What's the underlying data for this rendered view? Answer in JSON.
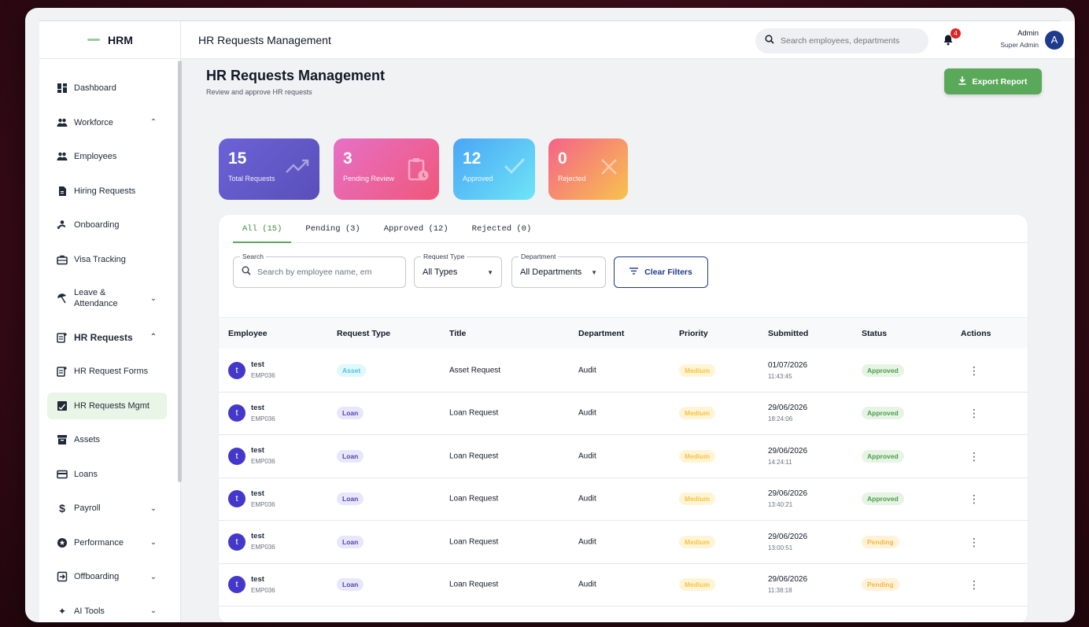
{
  "brand": {
    "name": "HRM"
  },
  "header": {
    "title": "HR Requests Management",
    "search_placeholder": "Search employees, departments",
    "notification_count": "4",
    "user_name": "Admin",
    "user_role": "Super Admin",
    "avatar_initial": "A"
  },
  "sidebar": {
    "items": [
      {
        "label": "Dashboard",
        "icon": "dashboard-icon"
      },
      {
        "label": "Workforce",
        "icon": "people-icon",
        "chevron": "^"
      },
      {
        "label": "Employees",
        "icon": "people-icon"
      },
      {
        "label": "Hiring Requests",
        "icon": "document-icon"
      },
      {
        "label": "Onboarding",
        "icon": "person-add-icon"
      },
      {
        "label": "Visa Tracking",
        "icon": "briefcase-icon"
      },
      {
        "label": "Leave & Attendance",
        "icon": "beach-icon",
        "chevron": "v"
      },
      {
        "label": "HR Requests",
        "icon": "request-icon",
        "chevron": "^"
      },
      {
        "label": "HR Request Forms",
        "icon": "request-icon"
      },
      {
        "label": "HR Requests Mgmt",
        "icon": "approval-icon"
      },
      {
        "label": "Assets",
        "icon": "archive-icon"
      },
      {
        "label": "Loans",
        "icon": "card-icon"
      },
      {
        "label": "Payroll",
        "icon": "dollar-icon",
        "chevron": "v"
      },
      {
        "label": "Performance",
        "icon": "star-icon",
        "chevron": "v"
      },
      {
        "label": "Offboarding",
        "icon": "exit-icon",
        "chevron": "v"
      },
      {
        "label": "AI Tools",
        "icon": "sparkle-icon",
        "chevron": "v"
      }
    ]
  },
  "page": {
    "title": "HR Requests Management",
    "subtitle": "Review and approve HR requests",
    "export_label": "Export Report"
  },
  "stats": {
    "total": {
      "value": "15",
      "label": "Total Requests"
    },
    "pending": {
      "value": "3",
      "label": "Pending Review"
    },
    "approved": {
      "value": "12",
      "label": "Approved"
    },
    "rejected": {
      "value": "0",
      "label": "Rejected"
    }
  },
  "tabs": [
    "All (15)",
    "Pending (3)",
    "Approved (12)",
    "Rejected (0)"
  ],
  "filters": {
    "search_label": "Search",
    "search_placeholder": "Search by employee name, em",
    "type_label": "Request Type",
    "type_value": "All Types",
    "dept_label": "Department",
    "dept_value": "All Departments",
    "clear_label": "Clear Filters"
  },
  "table": {
    "columns": [
      "Employee",
      "Request Type",
      "Title",
      "Department",
      "Priority",
      "Submitted",
      "Status",
      "Actions"
    ],
    "rows": [
      {
        "initial": "t",
        "name": "test",
        "id": "EMP036",
        "type": "Asset",
        "title": "Asset Request",
        "department": "Audit",
        "priority": "Medium",
        "date": "01/07/2026",
        "time": "11:43:45",
        "status": "Approved"
      },
      {
        "initial": "t",
        "name": "test",
        "id": "EMP036",
        "type": "Loan",
        "title": "Loan Request",
        "department": "Audit",
        "priority": "Medium",
        "date": "29/06/2026",
        "time": "18:24:06",
        "status": "Approved"
      },
      {
        "initial": "t",
        "name": "test",
        "id": "EMP036",
        "type": "Loan",
        "title": "Loan Request",
        "department": "Audit",
        "priority": "Medium",
        "date": "29/06/2026",
        "time": "14:24:11",
        "status": "Approved"
      },
      {
        "initial": "t",
        "name": "test",
        "id": "EMP036",
        "type": "Loan",
        "title": "Loan Request",
        "department": "Audit",
        "priority": "Medium",
        "date": "29/06/2026",
        "time": "13:40:21",
        "status": "Approved"
      },
      {
        "initial": "t",
        "name": "test",
        "id": "EMP036",
        "type": "Loan",
        "title": "Loan Request",
        "department": "Audit",
        "priority": "Medium",
        "date": "29/06/2026",
        "time": "13:00:51",
        "status": "Pending"
      },
      {
        "initial": "t",
        "name": "test",
        "id": "EMP036",
        "type": "Loan",
        "title": "Loan Request",
        "department": "Audit",
        "priority": "Medium",
        "date": "29/06/2026",
        "time": "11:38:18",
        "status": "Pending"
      }
    ]
  },
  "colors": {
    "accent": "#5aa85a",
    "navy": "#1e3a8a",
    "active_nav": "#e9f5e6"
  }
}
